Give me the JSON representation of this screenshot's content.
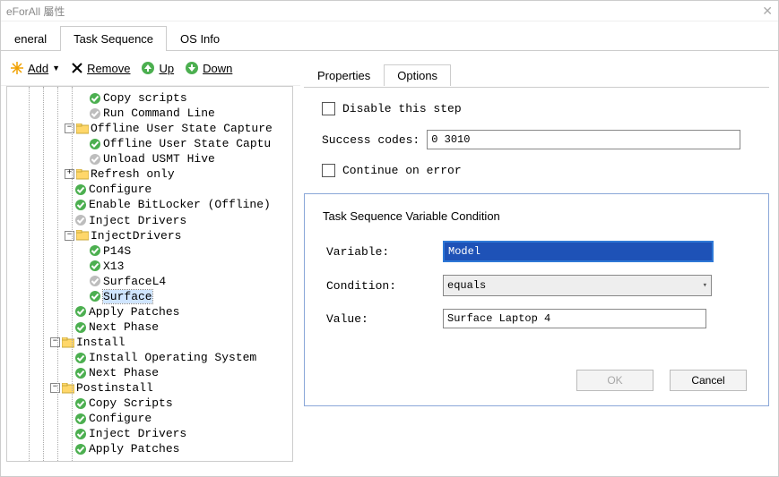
{
  "window": {
    "title": "eForAll 屬性"
  },
  "tabs": {
    "general": "eneral",
    "task_sequence": "Task Sequence",
    "os_info": "OS Info",
    "active": 1
  },
  "toolbar": {
    "add": "Add",
    "remove": "Remove",
    "up": "Up",
    "down": "Down"
  },
  "tree": [
    {
      "d": 4,
      "i": "ok",
      "t": "Copy scripts"
    },
    {
      "d": 4,
      "i": "gray",
      "t": "Run Command Line"
    },
    {
      "d": 3,
      "i": "folder",
      "pm": "-",
      "t": "Offline User State Capture"
    },
    {
      "d": 4,
      "i": "ok",
      "t": "Offline User State Captu"
    },
    {
      "d": 4,
      "i": "gray",
      "t": "Unload USMT Hive"
    },
    {
      "d": 3,
      "i": "folder",
      "pm": "+",
      "t": "Refresh only"
    },
    {
      "d": 3,
      "i": "ok",
      "t": "Configure"
    },
    {
      "d": 3,
      "i": "ok",
      "t": "Enable BitLocker (Offline)"
    },
    {
      "d": 3,
      "i": "gray",
      "t": "Inject Drivers"
    },
    {
      "d": 3,
      "i": "folder",
      "pm": "-",
      "t": "InjectDrivers"
    },
    {
      "d": 4,
      "i": "ok",
      "t": "P14S"
    },
    {
      "d": 4,
      "i": "ok",
      "t": "X13"
    },
    {
      "d": 4,
      "i": "gray",
      "t": "SurfaceL4"
    },
    {
      "d": 4,
      "i": "ok",
      "t": "Surface",
      "sel": true
    },
    {
      "d": 3,
      "i": "ok",
      "t": "Apply Patches"
    },
    {
      "d": 3,
      "i": "ok",
      "t": "Next Phase"
    },
    {
      "d": 2,
      "i": "folder",
      "pm": "-",
      "t": "Install"
    },
    {
      "d": 3,
      "i": "ok",
      "t": "Install Operating System"
    },
    {
      "d": 3,
      "i": "ok",
      "t": "Next Phase"
    },
    {
      "d": 2,
      "i": "folder",
      "pm": "-",
      "t": "Postinstall"
    },
    {
      "d": 3,
      "i": "ok",
      "t": "Copy Scripts"
    },
    {
      "d": 3,
      "i": "ok",
      "t": "Configure"
    },
    {
      "d": 3,
      "i": "ok",
      "t": "Inject Drivers"
    },
    {
      "d": 3,
      "i": "ok",
      "t": "Apply Patches"
    }
  ],
  "right": {
    "tabs": {
      "properties": "Properties",
      "options": "Options",
      "active": 1
    },
    "disable_step": "Disable this step",
    "success_codes_label": "Success codes:",
    "success_codes_value": "0 3010",
    "continue_on_error": "Continue on error",
    "group_title": "Task Sequence Variable Condition",
    "variable_label": "Variable:",
    "variable_value": "Model",
    "condition_label": "Condition:",
    "condition_value": "equals",
    "value_label": "Value:",
    "value_value": "Surface Laptop 4",
    "ok": "OK",
    "cancel": "Cancel"
  }
}
